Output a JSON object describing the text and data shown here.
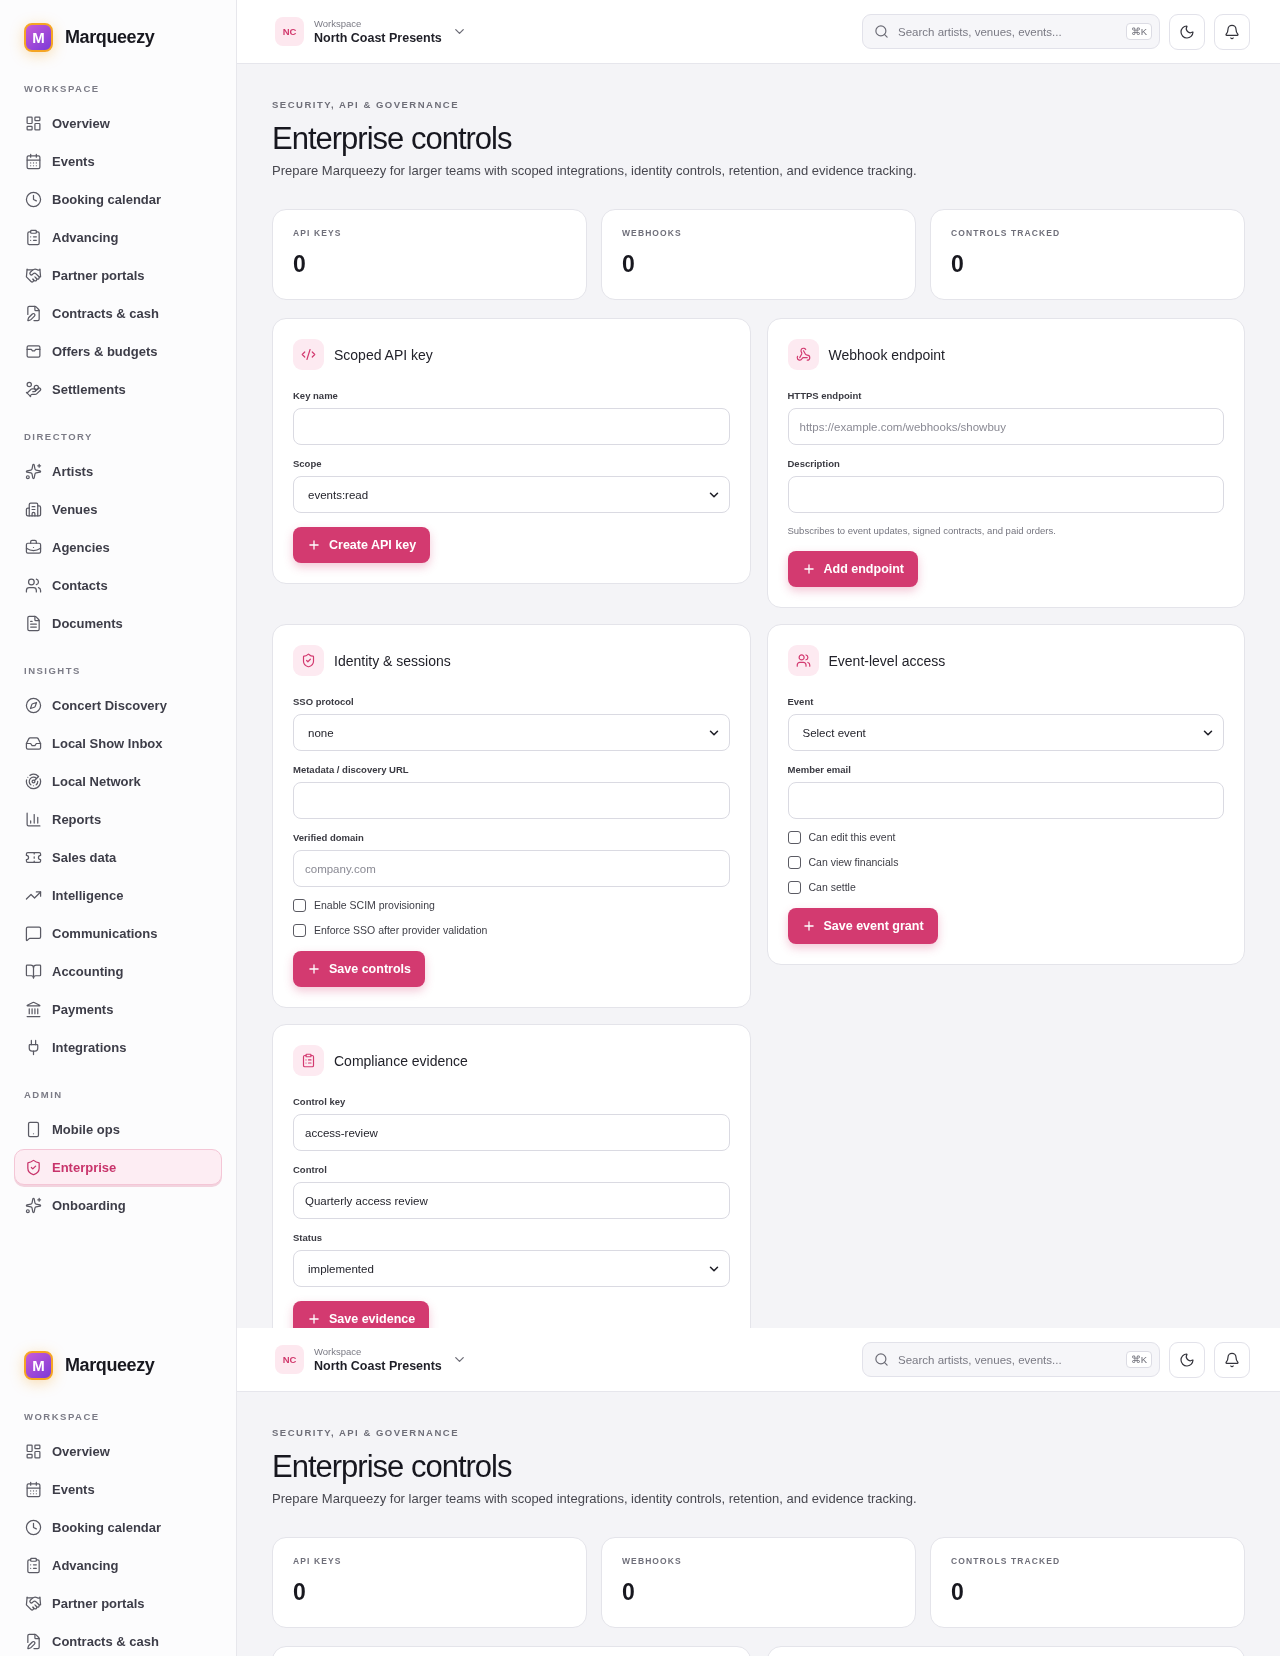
{
  "captures": [
    {
      "sidebar": {
        "brand": {
          "mark": "M",
          "name": "Marqueezy"
        },
        "sections": [
          {
            "title": "WORKSPACE",
            "items": [
              {
                "label": "Overview",
                "selected": false
              },
              {
                "label": "Events",
                "selected": false
              },
              {
                "label": "Booking calendar",
                "selected": false
              },
              {
                "label": "Advancing",
                "selected": false
              },
              {
                "label": "Partner portals",
                "selected": false
              },
              {
                "label": "Contracts & cash",
                "selected": false
              },
              {
                "label": "Offers & budgets",
                "selected": false
              },
              {
                "label": "Settlements",
                "selected": false
              }
            ]
          },
          {
            "title": "DIRECTORY",
            "items": [
              {
                "label": "Artists",
                "selected": false
              },
              {
                "label": "Venues",
                "selected": false
              },
              {
                "label": "Agencies",
                "selected": false
              },
              {
                "label": "Contacts",
                "selected": false
              },
              {
                "label": "Documents",
                "selected": false
              }
            ]
          },
          {
            "title": "INSIGHTS",
            "items": [
              {
                "label": "Concert Discovery",
                "selected": false
              },
              {
                "label": "Local Show Inbox",
                "selected": false
              },
              {
                "label": "Local Network",
                "selected": false
              },
              {
                "label": "Reports",
                "selected": false
              },
              {
                "label": "Sales data",
                "selected": false
              },
              {
                "label": "Intelligence",
                "selected": false
              },
              {
                "label": "Communications",
                "selected": false
              },
              {
                "label": "Accounting",
                "selected": false
              },
              {
                "label": "Payments",
                "selected": false
              },
              {
                "label": "Integrations",
                "selected": false
              }
            ]
          },
          {
            "title": "ADMIN",
            "items": [
              {
                "label": "Mobile ops",
                "selected": false
              },
              {
                "label": "Enterprise",
                "selected": true
              },
              {
                "label": "Onboarding",
                "selected": false
              }
            ]
          }
        ]
      },
      "header": {
        "workspace": {
          "initials": "NC",
          "caption": "Workspace",
          "name": "North Coast Presents"
        },
        "search": {
          "placeholder": "Search artists, venues, events...",
          "shortcut": "⌘K"
        }
      },
      "page": {
        "eyebrow": "SECURITY, API & GOVERNANCE",
        "title": "Enterprise controls",
        "description": "Prepare Marqueezy for larger teams with scoped integrations, identity controls, retention, and evidence tracking.",
        "stats": [
          {
            "label": "API KEYS",
            "value": "0"
          },
          {
            "label": "WEBHOOKS",
            "value": "0"
          },
          {
            "label": "CONTROLS TRACKED",
            "value": "0"
          }
        ],
        "cards": [
          {
            "kind": "form",
            "title": "Scoped API key",
            "fields": [
              {
                "kind": "input",
                "label": "Key name"
              },
              {
                "kind": "select",
                "label": "Scope",
                "value": "events:read"
              }
            ],
            "button": "Create API key"
          },
          {
            "kind": "form",
            "title": "Webhook endpoint",
            "fields": [
              {
                "kind": "input",
                "label": "HTTPS endpoint",
                "placeholder": "https://example.com/webhooks/showbuy"
              },
              {
                "kind": "input",
                "label": "Description"
              }
            ],
            "note": "Subscribes to event updates, signed contracts, and paid orders.",
            "button": "Add endpoint"
          },
          {
            "kind": "form",
            "title": "Identity & sessions",
            "fields": [
              {
                "kind": "select",
                "label": "SSO protocol",
                "value": "none"
              },
              {
                "kind": "input",
                "label": "Metadata / discovery URL"
              },
              {
                "kind": "input",
                "label": "Verified domain",
                "placeholder": "company.com"
              }
            ],
            "checks": [
              {
                "label": "Enable SCIM provisioning",
                "checked": false
              },
              {
                "label": "Enforce SSO after provider validation",
                "checked": false
              }
            ],
            "button": "Save controls"
          },
          {
            "kind": "form",
            "title": "Event-level access",
            "fields": [
              {
                "kind": "select",
                "label": "Event",
                "value": "Select event"
              },
              {
                "kind": "input",
                "label": "Member email"
              }
            ],
            "checks": [
              {
                "label": "Can edit this event",
                "checked": false
              },
              {
                "label": "Can view financials",
                "checked": false
              },
              {
                "label": "Can settle",
                "checked": false
              }
            ],
            "button": "Save event grant"
          },
          {
            "kind": "form",
            "title": "Compliance evidence",
            "fields": [
              {
                "kind": "input",
                "label": "Control key",
                "value": "access-review"
              },
              {
                "kind": "input",
                "label": "Control",
                "value": "Quarterly access review"
              },
              {
                "kind": "select",
                "label": "Status",
                "value": "implemented"
              }
            ],
            "button": "Save evidence"
          }
        ]
      }
    },
    {
      "sidebar": {
        "brand": {
          "mark": "M",
          "name": "Marqueezy"
        },
        "sections": [
          {
            "title": "WORKSPACE",
            "items": [
              {
                "label": "Overview",
                "selected": false
              },
              {
                "label": "Events",
                "selected": false
              },
              {
                "label": "Booking calendar",
                "selected": false
              },
              {
                "label": "Advancing",
                "selected": false
              },
              {
                "label": "Partner portals",
                "selected": false
              },
              {
                "label": "Contracts & cash",
                "selected": false
              }
            ]
          }
        ]
      },
      "header": {
        "workspace": {
          "initials": "NC",
          "caption": "Workspace",
          "name": "North Coast Presents"
        },
        "search": {
          "placeholder": "Search artists, venues, events...",
          "shortcut": "⌘K"
        }
      },
      "page": {
        "eyebrow": "SECURITY, API & GOVERNANCE",
        "title": "Enterprise controls",
        "description": "Prepare Marqueezy for larger teams with scoped integrations, identity controls, retention, and evidence tracking.",
        "stats": [
          {
            "label": "API KEYS",
            "value": "0"
          },
          {
            "label": "WEBHOOKS",
            "value": "0"
          },
          {
            "label": "CONTROLS TRACKED",
            "value": "0"
          }
        ],
        "cards": [
          {
            "kind": "blank"
          },
          {
            "kind": "blank"
          }
        ]
      }
    }
  ]
}
